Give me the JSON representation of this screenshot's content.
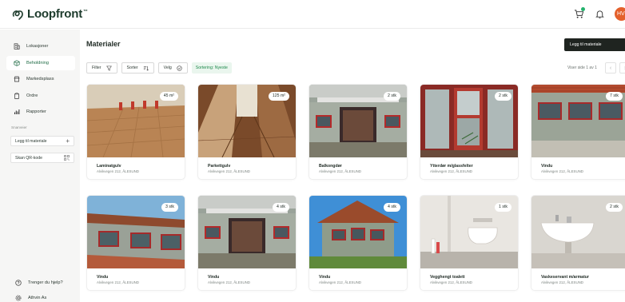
{
  "app": {
    "logo_text": "Loopfront",
    "logo_mark": "™",
    "avatar_initials": "HV"
  },
  "colors": {
    "accent": "#1f6b45",
    "sort_green": "#1f8a4c",
    "cart_dot": "#23b26d",
    "avatar": "#e4602b",
    "primary_button": "#1f2420"
  },
  "sidebar": {
    "items": [
      {
        "label": "Lokasjoner",
        "icon": "building-icon",
        "active": false
      },
      {
        "label": "Beholdning",
        "icon": "box-icon",
        "active": true
      },
      {
        "label": "Markedsplass",
        "icon": "store-icon",
        "active": false
      },
      {
        "label": "Ordre",
        "icon": "clipboard-icon",
        "active": false
      },
      {
        "label": "Rapporter",
        "icon": "bar-chart-icon",
        "active": false
      }
    ],
    "section_label": "Snarveier",
    "shortcut_add": "Legg til materiale",
    "shortcut_scan": "Skan QR-kode",
    "help": "Trenger du hjelp?",
    "company": "Athvin As"
  },
  "main": {
    "title": "Materialer",
    "add_button": "Legg til materiale",
    "filter_label": "Filter",
    "sort_label": "Sorter",
    "select_label": "Velg",
    "sort_chip": "Sortering: Nyeste",
    "pager_text": "Viser side 1 av 1",
    "pager_prev": "‹",
    "pager_next": "›"
  },
  "cards": [
    {
      "title": "Laminatgulv",
      "address": "Alvikvegen 212, ÅLESUND",
      "qty": "45 m²"
    },
    {
      "title": "Parkettgulv",
      "address": "Alvikvegen 212, ÅLESUND",
      "qty": "125 m²"
    },
    {
      "title": "Balkongdør",
      "address": "Alvikvegen 212, ÅLESUND",
      "qty": "2 stk"
    },
    {
      "title": "Ytterdør m/glassfelter",
      "address": "Alvikvegen 212, ÅLESUND",
      "qty": "2 stk"
    },
    {
      "title": "Vindu",
      "address": "Alvikvegen 212, ÅLESUND",
      "qty": "7 stk"
    },
    {
      "title": "Vindu",
      "address": "Alvikvegen 212, ÅLESUND",
      "qty": "3 stk"
    },
    {
      "title": "Vindu",
      "address": "Alvikvegen 212, ÅLESUND",
      "qty": "4 stk"
    },
    {
      "title": "Vindu",
      "address": "Alvikvegen 212, ÅLESUND",
      "qty": "4 stk"
    },
    {
      "title": "Vegghengt toalett",
      "address": "Alvikvegen 212, ÅLESUND",
      "qty": "1 stk"
    },
    {
      "title": "Vaskeservant m/armatur",
      "address": "Alvikvegen 212, ÅLESUND",
      "qty": "2 stk"
    }
  ]
}
